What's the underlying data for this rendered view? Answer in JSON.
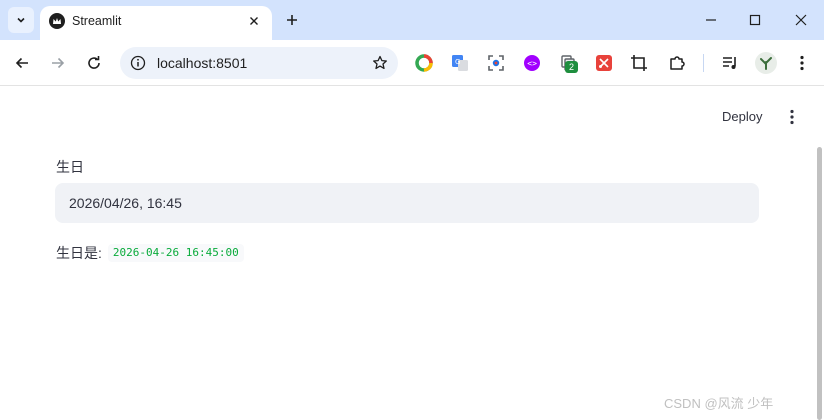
{
  "browser": {
    "tab": {
      "title": "Streamlit"
    },
    "omnibox": {
      "url": "localhost:8501"
    },
    "extensions": [
      {
        "name": "chrome-extension-color-icon",
        "color": "#e9443a"
      },
      {
        "name": "translate-icon",
        "color": "#4285f4"
      },
      {
        "name": "screenshot-icon",
        "color": "#1a73e8"
      },
      {
        "name": "api-icon",
        "color": "#a100ff"
      },
      {
        "name": "copy-extension-icon",
        "badge": "2"
      },
      {
        "name": "scissors-icon",
        "color": "#e8423b"
      },
      {
        "name": "crop-icon"
      },
      {
        "name": "puzzle-icon"
      }
    ]
  },
  "app": {
    "header": {
      "deploy_label": "Deploy"
    },
    "date_input": {
      "label": "生日",
      "value": "2026/04/26, 16:45"
    },
    "result": {
      "label": "生日是:",
      "value": "2026-04-26 16:45:00"
    }
  },
  "watermark": "CSDN @风流 少年",
  "colors": {
    "titlebar": "#d3e3fd",
    "input_bg": "#f0f2f6",
    "code_text": "#09ab3b",
    "text": "#31333f"
  }
}
